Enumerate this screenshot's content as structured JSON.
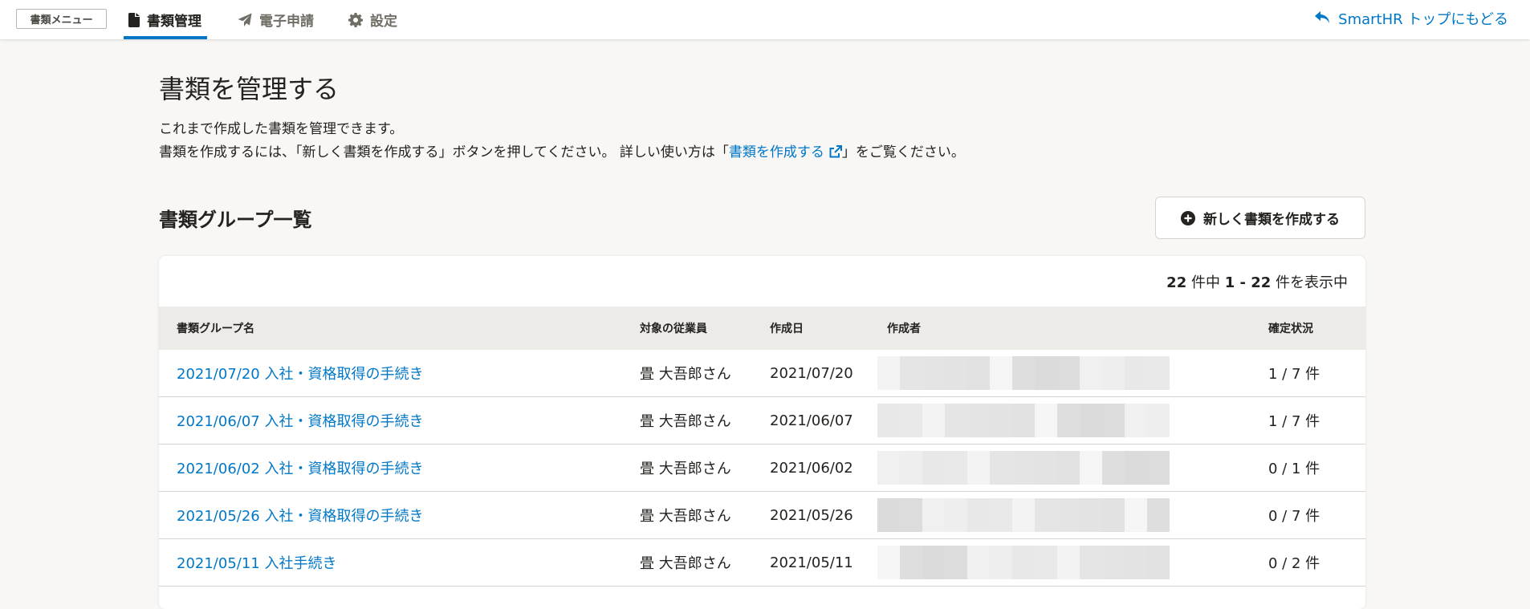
{
  "nav": {
    "menu_label": "書類メニュー",
    "tabs": [
      {
        "label": "書類管理",
        "icon": "file-icon",
        "active": true
      },
      {
        "label": "電子申請",
        "icon": "paper-plane-icon",
        "active": false
      },
      {
        "label": "設定",
        "icon": "gear-icon",
        "active": false
      }
    ],
    "back_label": "SmartHR トップにもどる",
    "back_icon": "reply-arrow-icon"
  },
  "page": {
    "title": "書類を管理する",
    "desc_line1": "これまで作成した書類を管理できます。",
    "desc_line2_pre": "書類を作成するには、「新しく書類を作成する」ボタンを押してください。 詳しい使い方は「",
    "desc_link": "書類を作成する",
    "desc_line2_post": "」をご覧ください。",
    "section_title": "書類グループ一覧",
    "create_button": "新しく書類を作成する"
  },
  "table": {
    "count_total": "22",
    "count_sep1": " 件中 ",
    "count_range": "1 - 22",
    "count_suffix": " 件を表示中",
    "headers": [
      "書類グループ名",
      "対象の従業員",
      "作成日",
      "作成者",
      "確定状況"
    ],
    "rows": [
      {
        "name": "2021/07/20 入社・資格取得の手続き",
        "employee": "畳 大吾郎さん",
        "date": "2021/07/20",
        "status": "1 / 7 件"
      },
      {
        "name": "2021/06/07 入社・資格取得の手続き",
        "employee": "畳 大吾郎さん",
        "date": "2021/06/07",
        "status": "1 / 7 件"
      },
      {
        "name": "2021/06/02 入社・資格取得の手続き",
        "employee": "畳 大吾郎さん",
        "date": "2021/06/02",
        "status": "0 / 1 件"
      },
      {
        "name": "2021/05/26 入社・資格取得の手続き",
        "employee": "畳 大吾郎さん",
        "date": "2021/05/26",
        "status": "0 / 7 件"
      },
      {
        "name": "2021/05/11 入社手続き",
        "employee": "畳 大吾郎さん",
        "date": "2021/05/11",
        "status": "0 / 2 件"
      }
    ]
  },
  "colors": {
    "accent": "#0077c7",
    "header_bg": "#edebe8",
    "page_bg": "#f8f7f6"
  }
}
